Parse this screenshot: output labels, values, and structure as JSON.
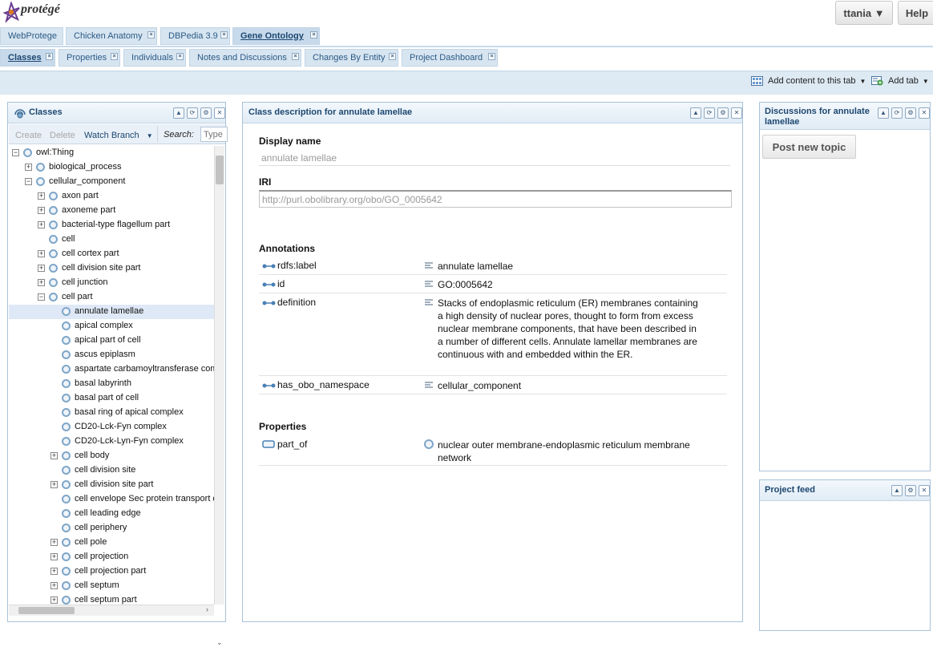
{
  "app": {
    "logo_text": "protégé"
  },
  "header": {
    "user_label": "ttania ▼",
    "help_label": "Help"
  },
  "project_tabs": [
    {
      "label": "WebProtege",
      "active": false,
      "closable": false
    },
    {
      "label": "Chicken Anatomy",
      "active": false,
      "closable": true
    },
    {
      "label": "DBPedia 3.9",
      "active": false,
      "closable": true
    },
    {
      "label": "Gene Ontology",
      "active": true,
      "closable": true
    }
  ],
  "view_tabs": [
    {
      "label": "Classes",
      "active": true
    },
    {
      "label": "Properties",
      "active": false
    },
    {
      "label": "Individuals",
      "active": false
    },
    {
      "label": "Notes and Discussions",
      "active": false
    },
    {
      "label": "Changes By Entity",
      "active": false
    },
    {
      "label": "Project Dashboard",
      "active": false
    }
  ],
  "toolbar": {
    "add_content_label": "Add content to this tab",
    "add_tab_label": "Add tab"
  },
  "classes_panel": {
    "title": "Classes",
    "create_label": "Create",
    "delete_label": "Delete",
    "watch_label": "Watch Branch",
    "search_label": "Search:",
    "search_placeholder": "Type",
    "tree": [
      {
        "label": "owl:Thing",
        "depth": 0,
        "state": "open"
      },
      {
        "label": "biological_process",
        "depth": 1,
        "state": "closed"
      },
      {
        "label": "cellular_component",
        "depth": 1,
        "state": "open"
      },
      {
        "label": "axon part",
        "depth": 2,
        "state": "closed"
      },
      {
        "label": "axoneme part",
        "depth": 2,
        "state": "closed"
      },
      {
        "label": "bacterial-type flagellum part",
        "depth": 2,
        "state": "closed"
      },
      {
        "label": "cell",
        "depth": 2,
        "state": "leaf"
      },
      {
        "label": "cell cortex part",
        "depth": 2,
        "state": "closed"
      },
      {
        "label": "cell division site part",
        "depth": 2,
        "state": "closed"
      },
      {
        "label": "cell junction",
        "depth": 2,
        "state": "closed"
      },
      {
        "label": "cell part",
        "depth": 2,
        "state": "open"
      },
      {
        "label": "annulate lamellae",
        "depth": 3,
        "state": "leaf",
        "selected": true
      },
      {
        "label": "apical complex",
        "depth": 3,
        "state": "leaf"
      },
      {
        "label": "apical part of cell",
        "depth": 3,
        "state": "leaf"
      },
      {
        "label": "ascus epiplasm",
        "depth": 3,
        "state": "leaf"
      },
      {
        "label": "aspartate carbamoyltransferase complex",
        "depth": 3,
        "state": "leaf"
      },
      {
        "label": "basal labyrinth",
        "depth": 3,
        "state": "leaf"
      },
      {
        "label": "basal part of cell",
        "depth": 3,
        "state": "leaf"
      },
      {
        "label": "basal ring of apical complex",
        "depth": 3,
        "state": "leaf"
      },
      {
        "label": "CD20-Lck-Fyn complex",
        "depth": 3,
        "state": "leaf"
      },
      {
        "label": "CD20-Lck-Lyn-Fyn complex",
        "depth": 3,
        "state": "leaf"
      },
      {
        "label": "cell body",
        "depth": 3,
        "state": "closed"
      },
      {
        "label": "cell division site",
        "depth": 3,
        "state": "leaf"
      },
      {
        "label": "cell division site part",
        "depth": 3,
        "state": "closed"
      },
      {
        "label": "cell envelope Sec protein transport complex",
        "depth": 3,
        "state": "leaf"
      },
      {
        "label": "cell leading edge",
        "depth": 3,
        "state": "leaf"
      },
      {
        "label": "cell periphery",
        "depth": 3,
        "state": "leaf"
      },
      {
        "label": "cell pole",
        "depth": 3,
        "state": "closed"
      },
      {
        "label": "cell projection",
        "depth": 3,
        "state": "closed"
      },
      {
        "label": "cell projection part",
        "depth": 3,
        "state": "closed"
      },
      {
        "label": "cell septum",
        "depth": 3,
        "state": "closed"
      },
      {
        "label": "cell septum part",
        "depth": 3,
        "state": "closed"
      }
    ]
  },
  "description_panel": {
    "title": "Class description for annulate lamellae",
    "display_name_label": "Display name",
    "display_name_value": "annulate lamellae",
    "iri_label": "IRI",
    "iri_value": "http://purl.obolibrary.org/obo/GO_0005642",
    "annotations_label": "Annotations",
    "annotations": [
      {
        "property": "rdfs:label",
        "value": "annulate lamellae"
      },
      {
        "property": "id",
        "value": "GO:0005642"
      },
      {
        "property": "definition",
        "value": "Stacks of endoplasmic reticulum (ER) membranes containing a high density of nuclear pores, thought to form from excess nuclear membrane components, that have been described in a number of different cells. Annulate lamellar membranes are continuous with and embedded within the ER."
      },
      {
        "property": "has_obo_namespace",
        "value": "cellular_component"
      }
    ],
    "properties_label": "Properties",
    "properties": [
      {
        "property": "part_of",
        "value": "nuclear outer membrane-endoplasmic reticulum membrane network"
      }
    ]
  },
  "discussions_panel": {
    "title": "Discussions for annulate lamellae",
    "post_label": "Post new topic"
  },
  "feed_panel": {
    "title": "Project feed"
  },
  "colors": {
    "accent": "#1c4770",
    "tab_bg": "#d7e5f1",
    "selection": "#dfe8f6"
  }
}
